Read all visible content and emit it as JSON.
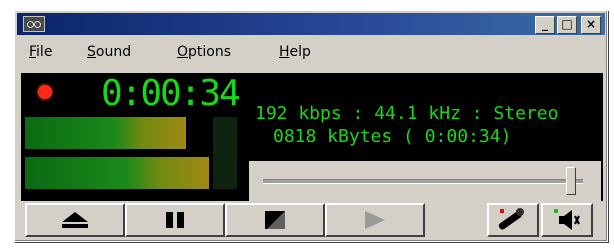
{
  "window": {
    "minimize_glyph": "_",
    "maximize_glyph": "□",
    "close_glyph": "×"
  },
  "menu": {
    "file": {
      "mnemonic": "F",
      "rest": "ile"
    },
    "sound": {
      "mnemonic": "S",
      "rest": "ound"
    },
    "options": {
      "mnemonic": "O",
      "rest": "ptions"
    },
    "help": {
      "mnemonic": "H",
      "rest": "elp"
    }
  },
  "display": {
    "elapsed_time": "0:00:34",
    "format_info": "192 kbps : 44.1 kHz : Stereo",
    "size_info": "0818 kBytes  (   0:00:34)",
    "level_left": 0.55,
    "level_right": 0.63
  },
  "volume_level": 0.96,
  "controls": {
    "eject_icon": "eject-icon",
    "pause_icon": "pause-icon",
    "stop_icon": "stop-icon",
    "play_icon": "play-icon",
    "microphone_icon": "microphone-icon",
    "speaker_icon": "speaker-icon"
  },
  "colors": {
    "lcd_text": "#18d818",
    "record_indicator": "#ff2a1a",
    "title_bar": "#0a246a",
    "face": "#d4d0c8"
  }
}
